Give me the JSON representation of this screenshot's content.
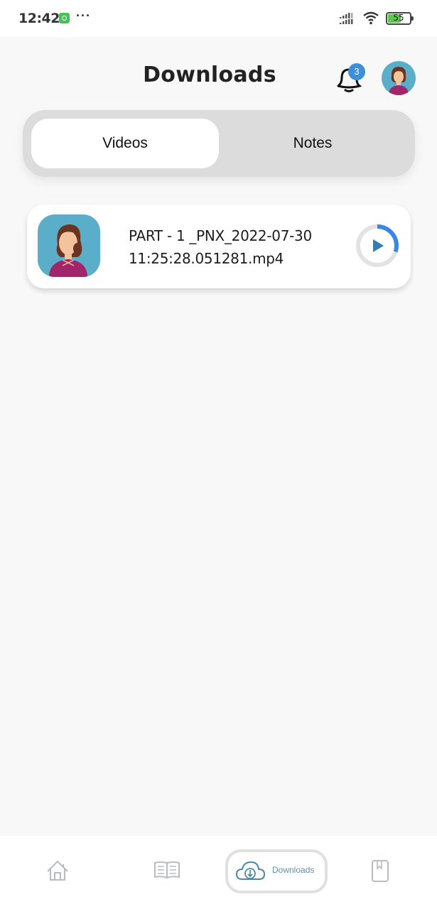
{
  "status_bar": {
    "time": "12:42",
    "overflow": "···",
    "battery_percent": "55",
    "icons": [
      "app-notification-icon",
      "signal-icon",
      "wifi-icon",
      "battery-icon"
    ]
  },
  "header": {
    "title": "Downloads",
    "notification_count": "3",
    "icons": [
      "bell-icon",
      "avatar"
    ]
  },
  "tabs": [
    {
      "label": "Videos",
      "active": true
    },
    {
      "label": "Notes",
      "active": false
    }
  ],
  "downloads": [
    {
      "title": "PART - 1 _PNX_2022-07-30 11:25:28.051281.mp4",
      "download_progress": 0.3,
      "action_icon": "play-icon"
    }
  ],
  "bottom_nav": [
    {
      "icon": "home-icon",
      "label": "",
      "active": false
    },
    {
      "icon": "book-icon",
      "label": "",
      "active": false
    },
    {
      "icon": "cloud-download-icon",
      "label": "Downloads",
      "active": true
    },
    {
      "icon": "bookmark-icon",
      "label": "",
      "active": false
    }
  ],
  "colors": {
    "accent": "#3d8fd8",
    "progress": "#3a85e8",
    "progress_track": "#e3e3e3",
    "play": "#2f7fb8",
    "nav_active": "#5f8fa6",
    "nav_inactive": "#b8bcc0",
    "avatar_bg": "#5aaec9"
  }
}
